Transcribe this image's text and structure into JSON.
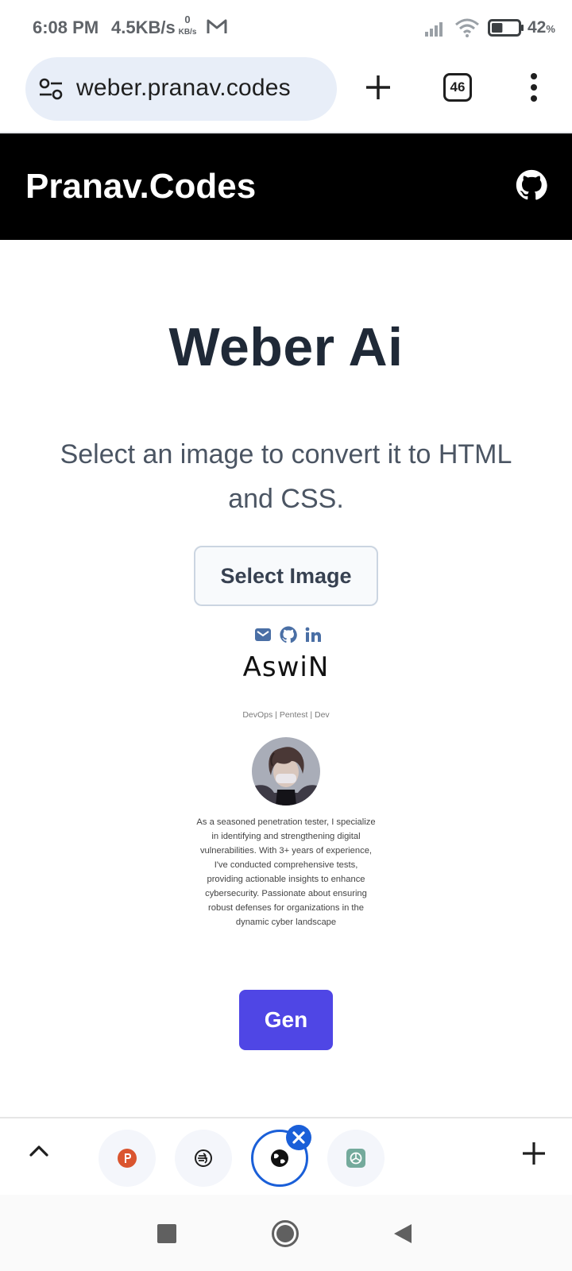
{
  "status_bar": {
    "time": "6:08 PM",
    "speed": "4.5KB/s",
    "speed_sub_value": "0",
    "speed_sub_unit": "KB/s",
    "battery_percent": "42",
    "battery_unit": "%",
    "battery_level": 0.42,
    "icons": [
      "gmail-icon",
      "signal-icon",
      "wifi-icon",
      "battery-icon"
    ]
  },
  "browser": {
    "url": "weber.pranav.codes",
    "tab_count": "46",
    "colors": {
      "url_bar_bg": "#e8eef8",
      "accent": "#1a5fd8"
    }
  },
  "site": {
    "brand": "Pranav.Codes",
    "header_bg": "#000000",
    "header_icon": "github-icon"
  },
  "main": {
    "title": "Weber Ai",
    "description": "Select an image to convert it to HTML and CSS.",
    "select_button": "Select Image",
    "generate_button": "Gen",
    "generate_color": "#4f46e5"
  },
  "preview": {
    "icons": [
      "email-icon",
      "github-icon",
      "linkedin-icon"
    ],
    "name": "AswiN",
    "tagline": "DevOps | Pentest | Dev",
    "bio": "As a seasoned penetration tester, I specialize in identifying and strengthening digital vulnerabilities. With 3+ years of experience, I've conducted comprehensive tests, providing actionable insights to enhance cybersecurity. Passionate about ensuring robust defenses for organizations in the dynamic cyber landscape"
  },
  "tab_strip": {
    "tabs": [
      {
        "icon": "producthunt-icon",
        "active": false
      },
      {
        "icon": "brain-icon",
        "active": false
      },
      {
        "icon": "globe-icon",
        "active": true
      },
      {
        "icon": "chatgpt-icon",
        "active": false
      }
    ]
  }
}
